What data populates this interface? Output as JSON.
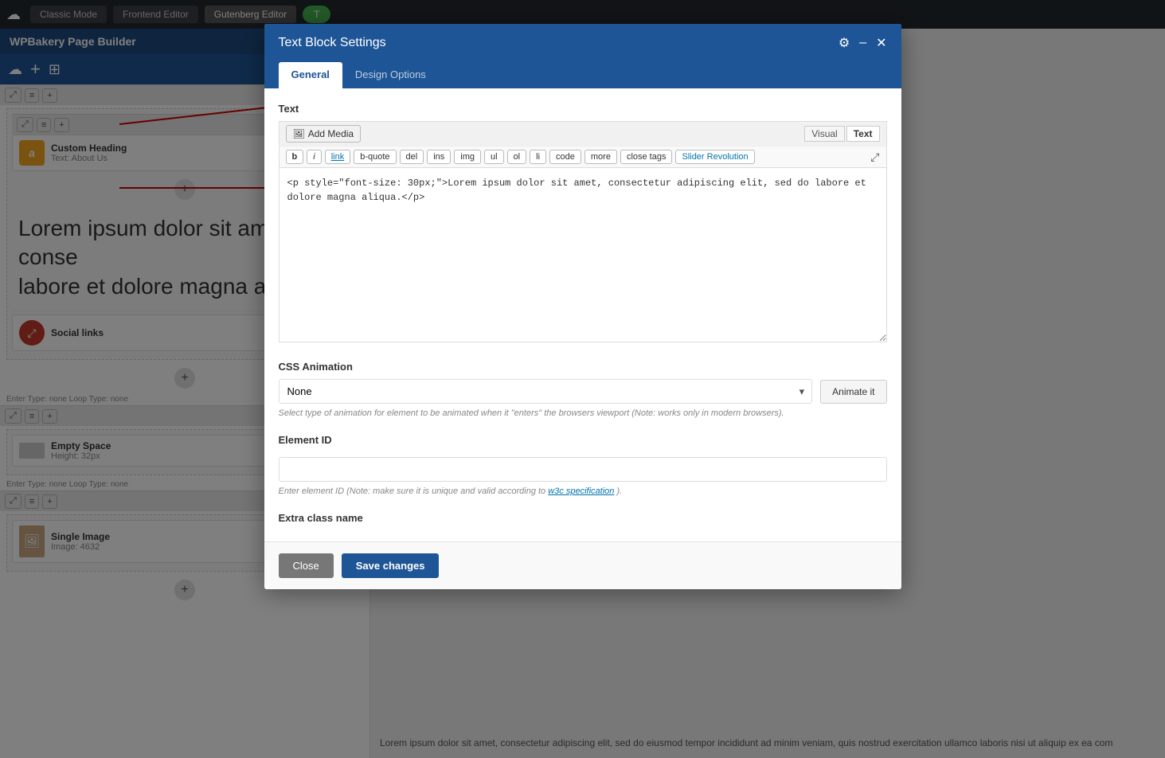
{
  "topnav": {
    "logo": "☁",
    "buttons": [
      {
        "label": "Classic Mode",
        "active": false
      },
      {
        "label": "Frontend Editor",
        "active": false
      },
      {
        "label": "Gutenberg Editor",
        "active": true
      },
      {
        "label": "T",
        "active": false,
        "green": true
      }
    ]
  },
  "sidebar": {
    "header_title": "WPBakery Page Builder",
    "loop_label_1": "Enter Type: none  Loop Type: none",
    "loop_label_2": "Enter Type: none  Loop Type: none"
  },
  "elements": [
    {
      "name": "Custom Heading",
      "sub": "Text: About Us",
      "icon_type": "yellow",
      "icon_char": "a"
    },
    {
      "name": "Social links",
      "icon_type": "red",
      "icon_char": "⤢"
    },
    {
      "name": "Empty Space",
      "sub": "Height: 32px",
      "icon_type": "empty"
    },
    {
      "name": "Single Image",
      "sub": "Image: 4632",
      "icon_type": "image"
    }
  ],
  "lorem_text": "Lorem ipsum dolor sit amet, conse labore et dolore magna aliqua.",
  "modal": {
    "title": "Text Block Settings",
    "tabs": [
      "General",
      "Design Options"
    ],
    "active_tab": "General",
    "section_text": "Text",
    "add_media_label": "Add Media",
    "view_visual": "Visual",
    "view_text": "Text",
    "format_buttons": [
      "b",
      "i",
      "link",
      "b-quote",
      "del",
      "ins",
      "img",
      "ul",
      "ol",
      "li",
      "code",
      "more",
      "close tags",
      "Slider Revolution"
    ],
    "code_content": "<p style=\"font-size: 30px;\">Lorem ipsum dolor sit amet, consectetur adipiscing elit, sed do labore et dolore magna aliqua.</p>",
    "css_animation_label": "CSS Animation",
    "css_animation_none": "None",
    "animate_btn": "Animate it",
    "animation_hint": "Select type of animation for element to be animated when it \"enters\" the browsers viewport (Note: works only in modern browsers).",
    "element_id_label": "Element ID",
    "element_id_hint": "Enter element ID (Note: make sure it is unique and valid according to",
    "w3c_link": "w3c specification",
    "element_id_hint2": ").",
    "extra_class_label": "Extra class name",
    "btn_close": "Close",
    "btn_save": "Save changes"
  },
  "bg_text": "Lorem ipsum dolor sit amet, consectetur adipiscing elit, sed do eiusmod tempor incididunt ad minim veniam, quis nostrud exercitation ullamco laboris nisi ut aliquip ex ea com"
}
